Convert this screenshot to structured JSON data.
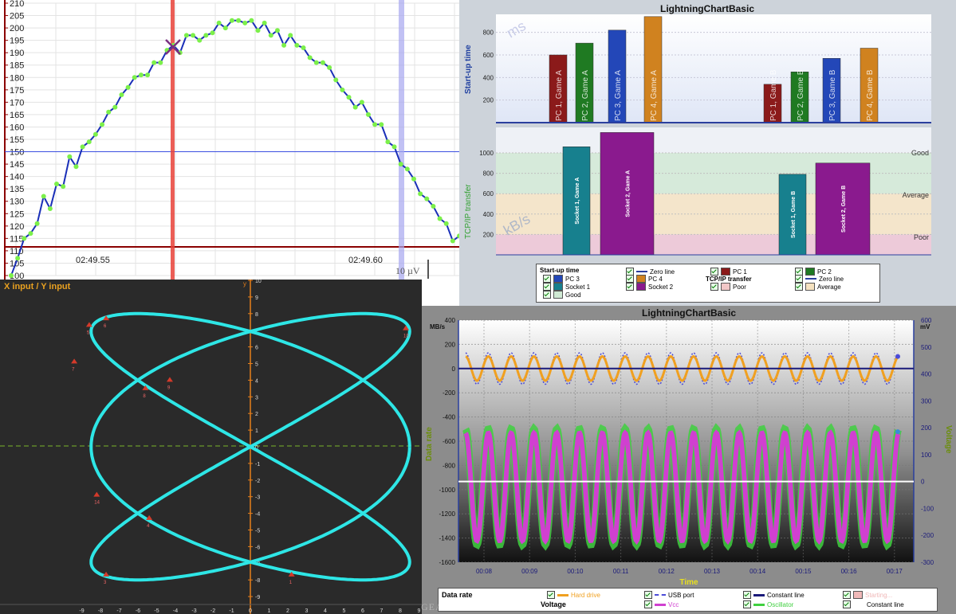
{
  "panel1": {
    "y_ticks": [
      "100",
      "105",
      "110",
      "115",
      "120",
      "125",
      "130",
      "135",
      "140",
      "145",
      "150",
      "155",
      "160",
      "165",
      "170",
      "175",
      "180",
      "185",
      "190",
      "195",
      "200",
      "205",
      "210"
    ],
    "x_ticks": [
      "02:49.55",
      "02:49.60"
    ],
    "scale_label": "10 µV",
    "colors": {
      "line": "#1a2fb8",
      "point": "#7cf04a",
      "cursor": "#e8423a",
      "cursor2": "#a7a7f0",
      "hline": "#3b4fe0",
      "axis": "#8b0000"
    },
    "chart_data": {
      "type": "line",
      "x": [
        0,
        1,
        2,
        3,
        4,
        5,
        6,
        7,
        8,
        9,
        10,
        11,
        12,
        13,
        14,
        15,
        16,
        17,
        18,
        19,
        20,
        21,
        22,
        23,
        24,
        25,
        26,
        27,
        28,
        29,
        30,
        31,
        32,
        33,
        34,
        35,
        36,
        37,
        38,
        39,
        40,
        41,
        42,
        43,
        44,
        45,
        46,
        47,
        48,
        49,
        50,
        51,
        52,
        53,
        54,
        55,
        56,
        57,
        58,
        59,
        60,
        61,
        62,
        63,
        64,
        65,
        66,
        67,
        68,
        69
      ],
      "values": [
        100,
        107,
        115,
        117,
        121,
        132,
        127,
        137,
        136,
        148,
        144,
        152,
        154,
        157,
        161,
        166,
        168,
        173,
        176,
        180,
        181,
        181,
        186,
        186,
        191,
        193,
        190,
        197,
        197,
        195,
        197,
        198,
        202,
        200,
        203,
        203,
        202,
        203,
        199,
        202,
        197,
        199,
        193,
        197,
        193,
        192,
        188,
        186,
        186,
        184,
        179,
        175,
        172,
        168,
        170,
        165,
        161,
        161,
        154,
        152,
        145,
        143,
        139,
        133,
        131,
        128,
        123,
        121,
        114,
        116
      ],
      "ylim": [
        100,
        210
      ],
      "title": "",
      "xlabel": "",
      "ylabel": ""
    }
  },
  "panel2": {
    "title": "LightningChartBasic",
    "unit_top": "ms",
    "unit_bottom": "kB/s",
    "y1_label": "Start-up time",
    "y2_label": "TCP/IP transfer",
    "y1_ticks": [
      "200",
      "400",
      "600",
      "800"
    ],
    "y2_ticks": [
      "200",
      "400",
      "600",
      "800",
      "1000"
    ],
    "bands": [
      {
        "label": "Good"
      },
      {
        "label": "Average"
      },
      {
        "label": "Poor"
      }
    ],
    "chart_data": [
      {
        "type": "bar",
        "title": "LightningChartBasic",
        "ylabel": "Start-up time",
        "ylim": [
          0,
          960
        ],
        "series": [
          {
            "name": "PC 1",
            "color": "#8b1a1a",
            "categories": [
              "PC 1, Game A",
              "PC 1, Game B"
            ],
            "values": [
              600,
              340
            ]
          },
          {
            "name": "PC 2",
            "color": "#1f7a22",
            "categories": [
              "PC 2, Game A",
              "PC 2, Game B"
            ],
            "values": [
              705,
              450
            ]
          },
          {
            "name": "PC 3",
            "color": "#2347b8",
            "categories": [
              "PC 3, Game A",
              "PC 3, Game B"
            ],
            "values": [
              820,
              570
            ]
          },
          {
            "name": "PC 4",
            "color": "#d0821f",
            "categories": [
              "PC 4, Game A",
              "PC 4, Game B"
            ],
            "values": [
              940,
              660
            ]
          }
        ]
      },
      {
        "type": "bar",
        "ylabel": "TCP/IP transfer",
        "ylim": [
          0,
          1250
        ],
        "series": [
          {
            "name": "Socket 1",
            "color": "#17808e",
            "categories": [
              "Socket 1, Game A",
              "Socket 1, Game B"
            ],
            "values": [
              1060,
              790
            ]
          },
          {
            "name": "Socket 2",
            "color": "#8a1a8e",
            "categories": [
              "Socket 2, Game A",
              "Socket 2, Game B"
            ],
            "values": [
              1200,
              900
            ]
          }
        ]
      }
    ],
    "legend": {
      "title1": "Start-up time",
      "title2": "TCP/IP transfer",
      "items": [
        {
          "label": "Zero line",
          "kind": "line",
          "color": "#2a3f9e"
        },
        {
          "label": "PC 1",
          "kind": "swatch",
          "color": "#8b1a1a"
        },
        {
          "label": "PC 2",
          "kind": "swatch",
          "color": "#1f7a22"
        },
        {
          "label": "PC 3",
          "kind": "swatch",
          "color": "#2347b8"
        },
        {
          "label": "PC 4",
          "kind": "swatch",
          "color": "#d0821f"
        },
        {
          "label": "Zero line",
          "kind": "line",
          "color": "#2a3f9e"
        },
        {
          "label": "Socket 1",
          "kind": "swatch",
          "color": "#17808e"
        },
        {
          "label": "Socket 2",
          "kind": "swatch",
          "color": "#8a1a8e"
        },
        {
          "label": "Poor",
          "kind": "swatch",
          "color": "#f2c7c7"
        },
        {
          "label": "Average",
          "kind": "swatch",
          "color": "#f5e2c0"
        },
        {
          "label": "Good",
          "kind": "swatch",
          "color": "#cfe9d3"
        }
      ]
    }
  },
  "panel3": {
    "title": "X input / Y input",
    "x_ticks": [
      "-9",
      "-8",
      "-7",
      "-6",
      "-5",
      "-4",
      "-3",
      "-2",
      "-1",
      "0",
      "1",
      "2",
      "3",
      "4",
      "5",
      "6",
      "7",
      "8",
      "9"
    ],
    "y_ticks": [
      "10",
      "9",
      "8",
      "7",
      "6",
      "5",
      "4",
      "3",
      "2",
      "1",
      "0",
      "-1",
      "-2",
      "-3",
      "-4",
      "-5",
      "-6",
      "-7",
      "-8",
      "-9"
    ],
    "axis_x_letter": "x",
    "axis_y_letter": "y",
    "colors": {
      "curve": "#2ee6e6",
      "axis": "#e87f1a",
      "marker": "#d43a2a"
    },
    "chart_data": {
      "type": "scatter",
      "x_function": "8.5*sin(3t+pi/2)",
      "y_function": "8*sin(2t)",
      "xlim": [
        -9.6,
        9.3
      ],
      "ylim": [
        -9.4,
        10
      ],
      "series": [
        {
          "name": "X input / Y input",
          "values": []
        }
      ]
    },
    "markers": [
      "5",
      "6",
      "7",
      "8",
      "9",
      "10",
      "14",
      "3",
      "4",
      "1"
    ]
  },
  "panel4": {
    "title": "LightningChartBasic",
    "y1_label": "Data rate",
    "y1_unit": "MB/s",
    "y2_label": "Voltage",
    "y2_unit": "mV",
    "x_label": "Time",
    "y1_ticks": [
      "400",
      "200",
      "0",
      "-200",
      "-400",
      "-600",
      "-800",
      "-1000",
      "-1200",
      "-1400",
      "-1600"
    ],
    "y2_ticks": [
      "600",
      "500",
      "400",
      "300",
      "200",
      "100",
      "0",
      "-100",
      "-200",
      "-300"
    ],
    "x_ticks": [
      "00:08",
      "00:09",
      "00:10",
      "00:11",
      "00:12",
      "00:13",
      "00:14",
      "00:15",
      "00:16",
      "00:17"
    ],
    "chart_data": {
      "type": "line",
      "xlabel": "Time",
      "ylabel": "Data rate",
      "ylim": [
        -1600,
        400
      ],
      "y2lim": [
        -300,
        600
      ],
      "x": [
        "00:08",
        "00:09",
        "00:10",
        "00:11",
        "00:12",
        "00:13",
        "00:14",
        "00:15",
        "00:16",
        "00:17"
      ],
      "series": [
        {
          "name": "Hard drive",
          "color": "#f0a020",
          "amplitude": 100,
          "offset": 0,
          "axis": "left"
        },
        {
          "name": "USB port",
          "color": "#4b4bd8",
          "amplitude": 130,
          "offset": 0,
          "axis": "left"
        },
        {
          "name": "Constant line",
          "color": "#1a1a7a",
          "value": 0,
          "axis": "left"
        },
        {
          "name": "Vcc",
          "color": "#d040d0",
          "amplitude": 200,
          "offset": 0,
          "axis": "right"
        },
        {
          "name": "Oscillator",
          "color": "#40d040",
          "amplitude": 215,
          "offset": 0,
          "axis": "right"
        },
        {
          "name": "Constant line",
          "color": "#ffffff",
          "value": 0,
          "axis": "right"
        }
      ]
    },
    "legend": {
      "title1": "Data rate",
      "title2": "Voltage",
      "items": [
        {
          "label": "Hard drive",
          "color": "#f0a020",
          "style": "solid"
        },
        {
          "label": "USB port",
          "color": "#4b4bd8",
          "style": "dash"
        },
        {
          "label": "Constant line",
          "color": "#1a1a7a",
          "style": "solid"
        },
        {
          "label": "Starting...",
          "color": "#f0b8b8",
          "style": "swatch"
        },
        {
          "label": "Vcc",
          "color": "#d040d0",
          "style": "solid"
        },
        {
          "label": "Oscillator",
          "color": "#40d040",
          "style": "solid"
        },
        {
          "label": "Constant line",
          "color": "#ffffff",
          "style": "solid"
        }
      ]
    }
  },
  "watermark": "GEARDOWNLOAD.com"
}
